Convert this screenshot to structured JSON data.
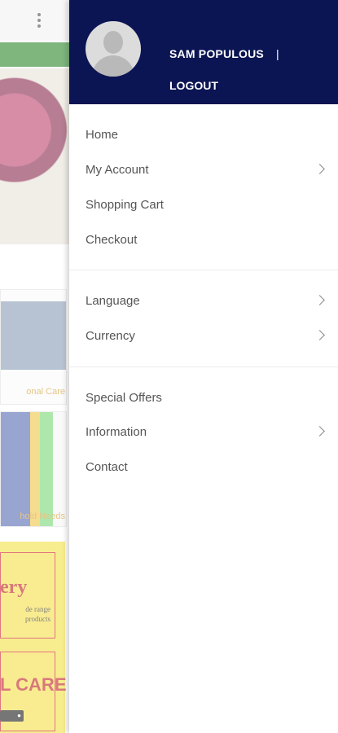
{
  "drawer": {
    "user_name": "SAM POPULOUS",
    "separator": "|",
    "logout_label": "LOGOUT",
    "sections": [
      {
        "items": [
          {
            "label": "Home",
            "has_submenu": false
          },
          {
            "label": "My Account",
            "has_submenu": true
          },
          {
            "label": "Shopping Cart",
            "has_submenu": false
          },
          {
            "label": "Checkout",
            "has_submenu": false
          }
        ]
      },
      {
        "items": [
          {
            "label": "Language",
            "has_submenu": true
          },
          {
            "label": "Currency",
            "has_submenu": true
          }
        ]
      },
      {
        "items": [
          {
            "label": "Special Offers",
            "has_submenu": false
          },
          {
            "label": "Information",
            "has_submenu": true
          },
          {
            "label": "Contact",
            "has_submenu": false
          }
        ]
      }
    ]
  },
  "background": {
    "card_labels": [
      "onal Care",
      "hold Needs"
    ],
    "promo_word": "ery",
    "promo_sub": "de range products",
    "promo_word2": "L CARE"
  },
  "colors": {
    "header_bg": "#0b1553",
    "menu_text": "#555555"
  }
}
